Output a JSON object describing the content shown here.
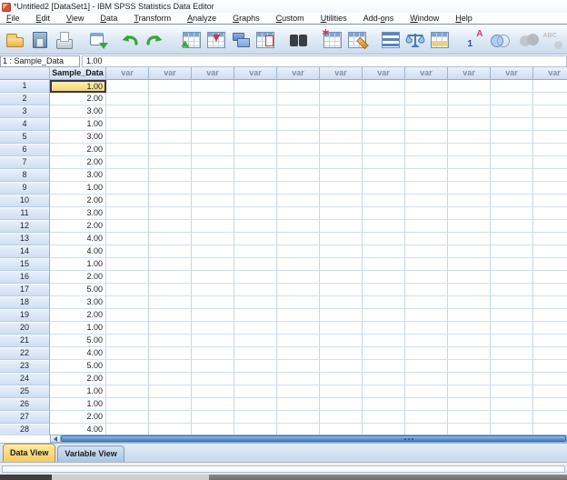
{
  "window": {
    "title": "*Untitled2 [DataSet1] - IBM SPSS Statistics Data Editor"
  },
  "menu_bar": {
    "items": [
      {
        "label": "File",
        "underline": 0
      },
      {
        "label": "Edit",
        "underline": 0
      },
      {
        "label": "View",
        "underline": 0
      },
      {
        "label": "Data",
        "underline": 0
      },
      {
        "label": "Transform",
        "underline": 0
      },
      {
        "label": "Analyze",
        "underline": 0
      },
      {
        "label": "Graphs",
        "underline": 0
      },
      {
        "label": "Custom",
        "underline": 0
      },
      {
        "label": "Utilities",
        "underline": 0
      },
      {
        "label": "Add-ons",
        "underline": 4
      },
      {
        "label": "Window",
        "underline": 0
      },
      {
        "label": "Help",
        "underline": 0
      }
    ]
  },
  "toolbar": {
    "buttons": [
      {
        "name": "open-data"
      },
      {
        "name": "save"
      },
      {
        "name": "print"
      },
      {
        "name": "recall-dialogs"
      },
      {
        "name": "undo"
      },
      {
        "name": "redo"
      },
      {
        "name": "goto-case"
      },
      {
        "name": "goto-variable"
      },
      {
        "name": "variables"
      },
      {
        "name": "variable-properties"
      },
      {
        "name": "find"
      },
      {
        "name": "insert-cases"
      },
      {
        "name": "insert-variable"
      },
      {
        "name": "split-file"
      },
      {
        "name": "weight-cases"
      },
      {
        "name": "select-cases"
      },
      {
        "name": "value-labels"
      },
      {
        "name": "use-variable-sets"
      },
      {
        "name": "show-all-variables",
        "disabled": true
      },
      {
        "name": "spell-check",
        "disabled": true
      }
    ]
  },
  "cell_reference": {
    "label": "1 : Sample_Data",
    "value": "1.00"
  },
  "grid": {
    "corner_label": "",
    "data_column_header": "Sample_Data",
    "var_header_label": "var",
    "var_column_count": 11,
    "selected_cell": {
      "row": 1,
      "column": "Sample_Data"
    },
    "rows": [
      {
        "n": "1",
        "value": "1.00"
      },
      {
        "n": "2",
        "value": "2.00"
      },
      {
        "n": "3",
        "value": "3.00"
      },
      {
        "n": "4",
        "value": "1.00"
      },
      {
        "n": "5",
        "value": "3.00"
      },
      {
        "n": "6",
        "value": "2.00"
      },
      {
        "n": "7",
        "value": "2.00"
      },
      {
        "n": "8",
        "value": "3.00"
      },
      {
        "n": "9",
        "value": "1.00"
      },
      {
        "n": "10",
        "value": "2.00"
      },
      {
        "n": "11",
        "value": "3.00"
      },
      {
        "n": "12",
        "value": "2.00"
      },
      {
        "n": "13",
        "value": "4.00"
      },
      {
        "n": "14",
        "value": "4.00"
      },
      {
        "n": "15",
        "value": "1.00"
      },
      {
        "n": "16",
        "value": "2.00"
      },
      {
        "n": "17",
        "value": "5.00"
      },
      {
        "n": "18",
        "value": "3.00"
      },
      {
        "n": "19",
        "value": "2.00"
      },
      {
        "n": "20",
        "value": "1.00"
      },
      {
        "n": "21",
        "value": "5.00"
      },
      {
        "n": "22",
        "value": "4.00"
      },
      {
        "n": "23",
        "value": "5.00"
      },
      {
        "n": "24",
        "value": "2.00"
      },
      {
        "n": "25",
        "value": "1.00"
      },
      {
        "n": "26",
        "value": "1.00"
      },
      {
        "n": "27",
        "value": "2.00"
      },
      {
        "n": "28",
        "value": "4.00"
      }
    ]
  },
  "tabs": {
    "items": [
      {
        "label": "Data View",
        "active": true
      },
      {
        "label": "Variable View",
        "active": false
      }
    ]
  },
  "colors": {
    "selected_cell_bg": "#f2d678",
    "header_blue": "#cdddf0",
    "active_tab": "#f3cb62",
    "scrollbar_blue": "#5e95cf",
    "accent_green": "#3fa53f",
    "accent_red": "#c43b3b"
  }
}
